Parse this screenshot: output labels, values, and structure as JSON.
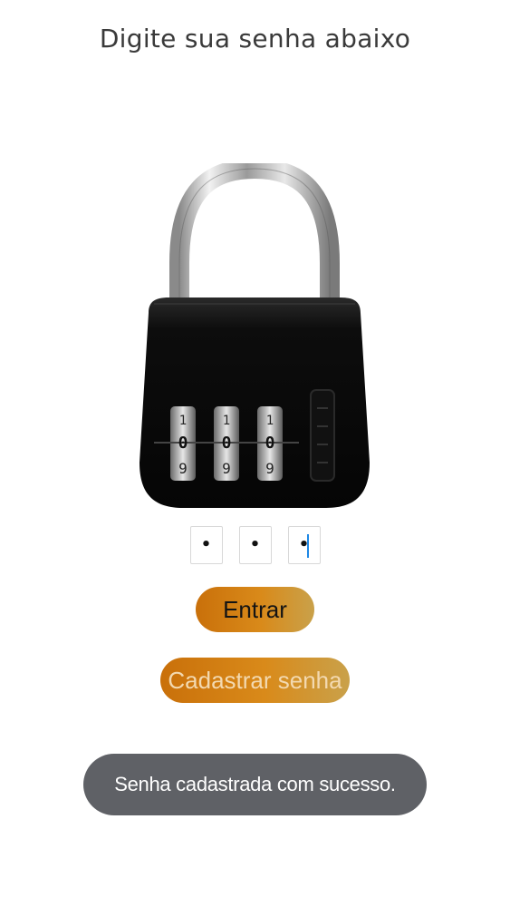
{
  "header": {
    "title": "Digite sua senha abaixo"
  },
  "lock_image": {
    "digits": [
      "1",
      "0",
      "9"
    ]
  },
  "password": {
    "pins": [
      {
        "value": "•",
        "focused": false
      },
      {
        "value": "•",
        "focused": false
      },
      {
        "value": "•",
        "focused": true
      }
    ]
  },
  "buttons": {
    "enter_label": "Entrar",
    "register_label": "Cadastrar senha"
  },
  "toast": {
    "message": "Senha cadastrada com sucesso."
  },
  "colors": {
    "button_orange": "#d98a1a",
    "toast_gray": "#5f6166",
    "caret_blue": "#1e88e5"
  }
}
